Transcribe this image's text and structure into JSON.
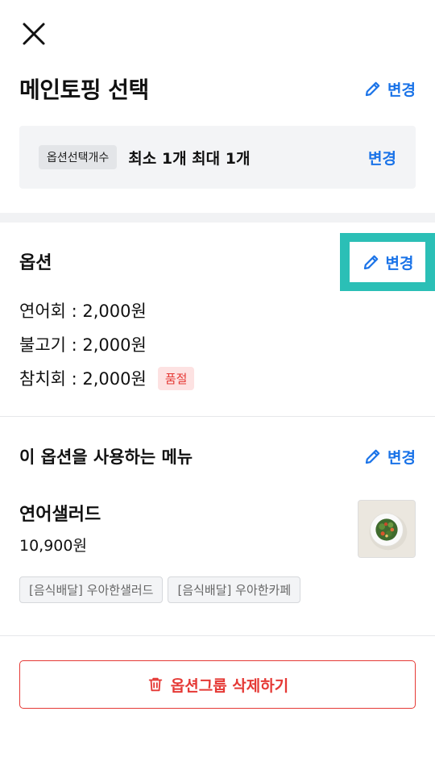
{
  "header": {
    "title": "메인토핑 선택",
    "edit_label": "변경"
  },
  "option_count": {
    "chip_label": "옵션선택개수",
    "value": "최소 1개 최대 1개",
    "edit_label": "변경"
  },
  "options": {
    "title": "옵션",
    "edit_label": "변경",
    "items": [
      {
        "label": "연어회 : 2,000원"
      },
      {
        "label": "불고기 : 2,000원"
      },
      {
        "label": "참치회 : 2,000원",
        "badge": "품절"
      }
    ]
  },
  "menus": {
    "title": "이 옵션을 사용하는 메뉴",
    "edit_label": "변경",
    "item": {
      "name": "연어샐러드",
      "price": "10,900원",
      "stores": [
        "[음식배달] 우아한샐러드",
        "[음식배달] 우아한카페"
      ]
    }
  },
  "delete_button": {
    "label": "옵션그룹 삭제하기"
  },
  "colors": {
    "accent": "#1a73e8",
    "danger": "#e53935",
    "highlight": "#2bbfb6"
  },
  "icons": {
    "close": "close-icon",
    "edit": "pencil-icon",
    "delete": "trash-icon"
  }
}
